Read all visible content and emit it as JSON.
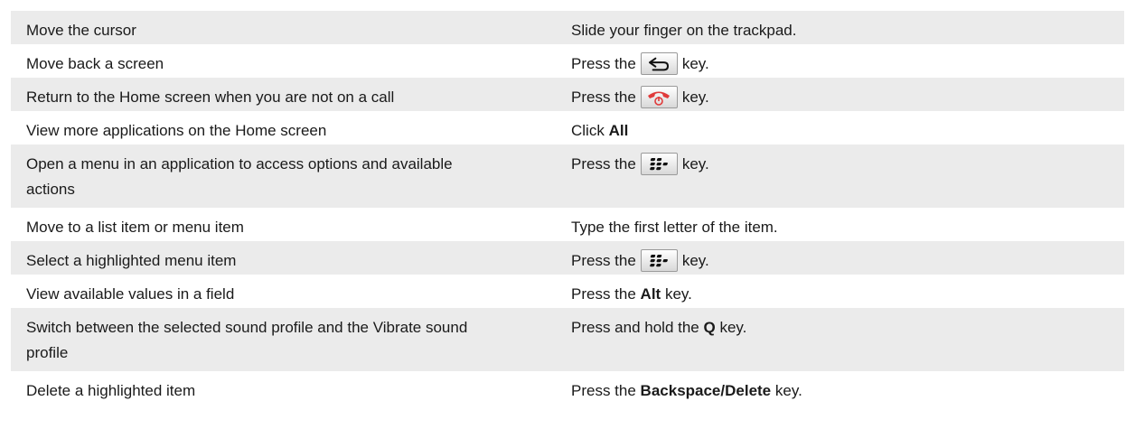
{
  "rows": [
    {
      "task": [
        "Move the cursor"
      ],
      "prefix": "Slide your finger on the trackpad.",
      "key": "",
      "bold": "",
      "suffix": "",
      "shaded": true,
      "tall": false
    },
    {
      "task": [
        "Move back a screen"
      ],
      "prefix": "Press the",
      "key": "back-icon",
      "bold": "",
      "suffix": "key.",
      "shaded": false,
      "tall": false
    },
    {
      "task": [
        "Return to the Home screen when you are not on a call"
      ],
      "prefix": "Press the",
      "key": "end-call-icon",
      "bold": "",
      "suffix": "key.",
      "shaded": true,
      "tall": false
    },
    {
      "task": [
        "View more applications on the Home screen"
      ],
      "prefix": "Click",
      "key": "",
      "bold": "All",
      "suffix": "",
      "shaded": false,
      "tall": false
    },
    {
      "task": [
        "Open a menu in an application to access options and available",
        "actions"
      ],
      "prefix": "Press the",
      "key": "menu-icon",
      "bold": "",
      "suffix": "key.",
      "shaded": true,
      "tall": true
    },
    {
      "task": [
        "Move to a list item or menu item"
      ],
      "prefix": "Type the first letter of the item.",
      "key": "",
      "bold": "",
      "suffix": "",
      "shaded": false,
      "tall": false
    },
    {
      "task": [
        "Select a highlighted menu item"
      ],
      "prefix": "Press the",
      "key": "menu-icon",
      "bold": "",
      "suffix": "key.",
      "shaded": true,
      "tall": false
    },
    {
      "task": [
        "View available values in a field"
      ],
      "prefix": "Press the",
      "key": "",
      "bold": "Alt",
      "suffix": "key.",
      "shaded": false,
      "tall": false
    },
    {
      "task": [
        "Switch between the selected sound profile and the Vibrate sound",
        "profile"
      ],
      "prefix": "Press and hold the",
      "key": "",
      "bold": "Q",
      "suffix": "key.",
      "shaded": true,
      "tall": true
    },
    {
      "task": [
        "Delete a highlighted item"
      ],
      "prefix": "Press the",
      "key": "",
      "bold": "Backspace/Delete",
      "suffix": "key.",
      "shaded": false,
      "tall": false
    }
  ],
  "colors": {
    "shaded_row": "#ebebeb",
    "end_call_key": "#e03a3a"
  }
}
